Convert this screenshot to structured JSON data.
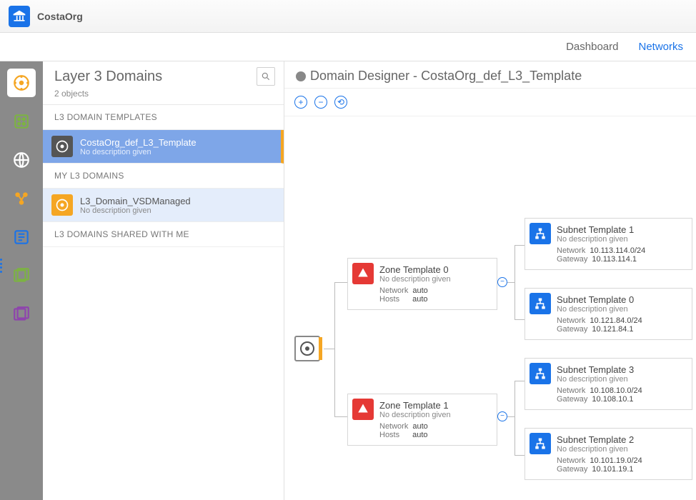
{
  "app": {
    "title": "CostaOrg"
  },
  "tabs": {
    "dashboard": "Dashboard",
    "networks": "Networks"
  },
  "nav": [
    {
      "name": "l3-domains",
      "color": "#f5a623",
      "selected": true
    },
    {
      "name": "l2-domains",
      "color": "#7cb342"
    },
    {
      "name": "globe",
      "color": "#ffffff"
    },
    {
      "name": "services",
      "color": "#f5a623"
    },
    {
      "name": "policies",
      "color": "#1a73e8"
    },
    {
      "name": "templates-a",
      "color": "#7cb342"
    },
    {
      "name": "templates-b",
      "color": "#8e44ad"
    }
  ],
  "list": {
    "title": "Layer 3 Domains",
    "count": "2 objects",
    "sections": {
      "templates": "L3 DOMAIN TEMPLATES",
      "mine": "MY L3 DOMAINS",
      "shared": "L3 DOMAINS SHARED WITH ME"
    },
    "template_item": {
      "name": "CostaOrg_def_L3_Template",
      "desc": "No description given"
    },
    "mine_item": {
      "name": "L3_Domain_VSDManaged",
      "desc": "No description given"
    }
  },
  "designer": {
    "title_prefix": "Domain Designer - ",
    "title_name": "CostaOrg_def_L3_Template"
  },
  "zones": [
    {
      "name": "Zone Template 0",
      "desc": "No description given",
      "network_label": "Network",
      "network": "auto",
      "hosts_label": "Hosts",
      "hosts": "auto"
    },
    {
      "name": "Zone Template 1",
      "desc": "No description given",
      "network_label": "Network",
      "network": "auto",
      "hosts_label": "Hosts",
      "hosts": "auto"
    }
  ],
  "subnets": [
    {
      "name": "Subnet Template 1",
      "desc": "No description given",
      "network_label": "Network",
      "network": "10.113.114.0/24",
      "gateway_label": "Gateway",
      "gateway": "10.113.114.1"
    },
    {
      "name": "Subnet Template 0",
      "desc": "No description given",
      "network_label": "Network",
      "network": "10.121.84.0/24",
      "gateway_label": "Gateway",
      "10": "",
      "gateway": "10.121.84.1"
    },
    {
      "name": "Subnet Template 3",
      "desc": "No description given",
      "network_label": "Network",
      "network": "10.108.10.0/24",
      "gateway_label": "Gateway",
      "gateway": "10.108.10.1"
    },
    {
      "name": "Subnet Template 2",
      "desc": "No description given",
      "network_label": "Network",
      "network": "10.101.19.0/24",
      "gateway_label": "Gateway",
      "gateway": "10.101.19.1"
    }
  ]
}
